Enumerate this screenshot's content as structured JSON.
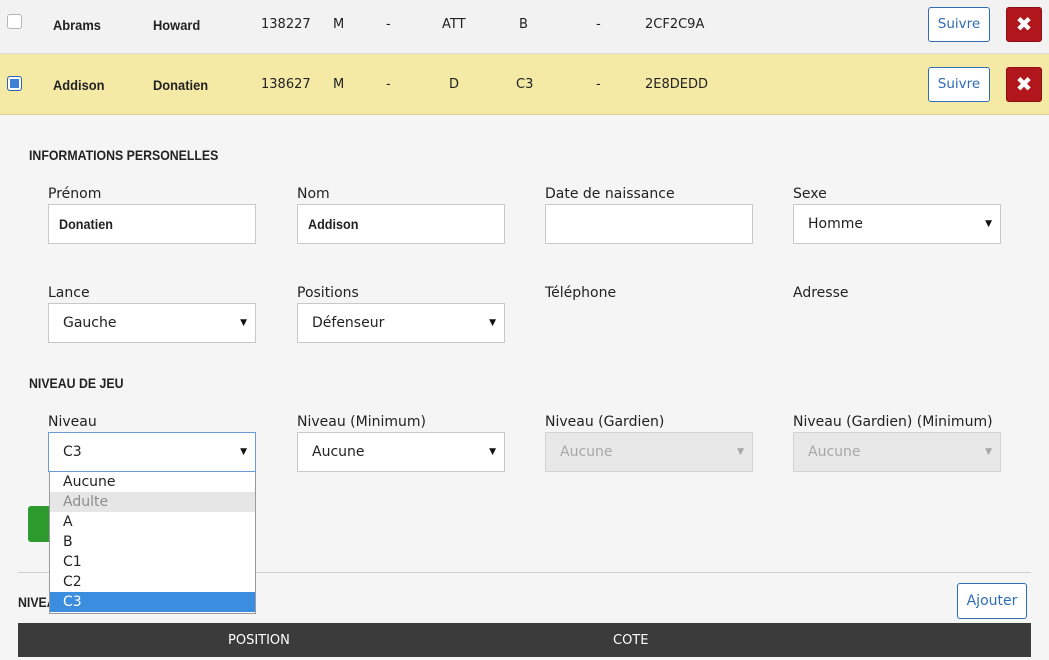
{
  "players": [
    {
      "last": "Abrams",
      "first": "Howard",
      "number": "138227",
      "sex": "M",
      "col5": "-",
      "position": "ATT",
      "level": "B",
      "col8": "-",
      "code": "2CF2C9A",
      "follow_label": "Suivre",
      "delete_label": "✖"
    },
    {
      "last": "Addison",
      "first": "Donatien",
      "number": "138627",
      "sex": "M",
      "col5": "-",
      "position": "D",
      "level": "C3",
      "col8": "-",
      "code": "2E8DEDD",
      "follow_label": "Suivre",
      "delete_label": "✖"
    }
  ],
  "personal": {
    "section_title": "INFORMATIONS PERSONELLES",
    "prenom_label": "Prénom",
    "prenom_value": "Donatien",
    "nom_label": "Nom",
    "nom_value": "Addison",
    "dob_label": "Date de naissance",
    "dob_value": "",
    "sexe_label": "Sexe",
    "sexe_value": "Homme",
    "lance_label": "Lance",
    "lance_value": "Gauche",
    "positions_label": "Positions",
    "positions_value": "Défenseur",
    "telephone_label": "Téléphone",
    "adresse_label": "Adresse"
  },
  "game_level": {
    "section_title": "NIVEAU DE JEU",
    "niveau_label": "Niveau",
    "niveau_value": "C3",
    "niveau_min_label": "Niveau (Minimum)",
    "niveau_min_value": "Aucune",
    "gardien_label": "Niveau (Gardien)",
    "gardien_value": "Aucune",
    "gardien_min_label": "Niveau (Gardien) (Minimum)",
    "gardien_min_value": "Aucune",
    "dropdown_options": [
      "Aucune",
      "Adulte",
      "A",
      "B",
      "C1",
      "C2",
      "C3"
    ]
  },
  "levels_section": {
    "title_visible": "NIVEA",
    "add_label": "Ajouter",
    "col_position": "POSITION",
    "col_cote": "COTE"
  },
  "colors": {
    "selected_row": "#f4eaa6",
    "primary_blue": "#2f6db5",
    "danger_red": "#b0161c",
    "success_green": "#2e9b2e",
    "selected_option": "#3b8de0",
    "table_header": "#3b3b3b"
  },
  "icons": {
    "delete": "close-icon",
    "select_arrow": "caret-down-icon"
  }
}
